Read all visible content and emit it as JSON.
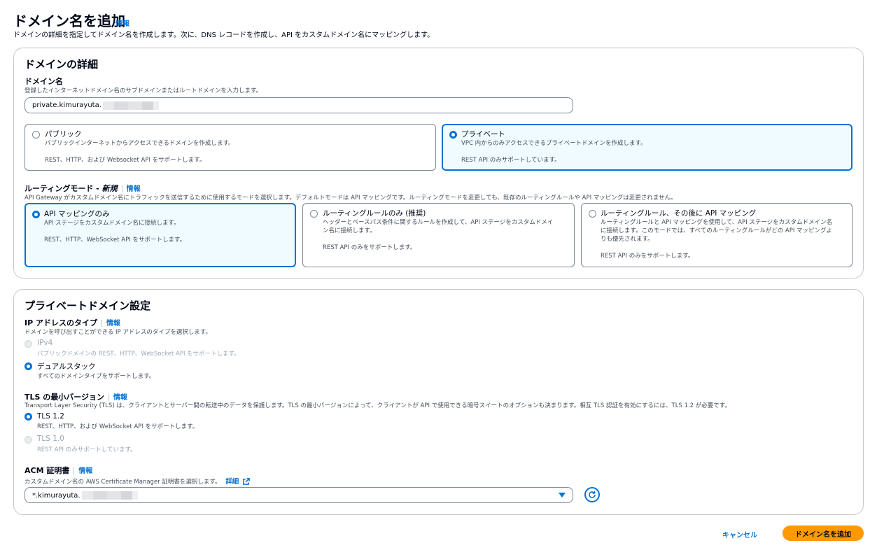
{
  "header": {
    "title": "ドメイン名を追加",
    "info": "情報",
    "description": "ドメインの詳細を指定してドメイン名を作成します。次に、DNS レコードを作成し、API をカスタムドメイン名にマッピングします。"
  },
  "domain_details": {
    "title": "ドメインの詳細",
    "domain_name_label": "ドメイン名",
    "domain_name_desc": "登録したインターネットドメイン名のサブドメインまたはルートドメインを入力します。",
    "domain_name_value": "private.kimurayuta.",
    "visibility": [
      {
        "title": "パブリック",
        "desc": "パブリックインターネットからアクセスできるドメインを作成します。",
        "note": "REST、HTTP、および Websocket API をサポートします。",
        "selected": false
      },
      {
        "title": "プライベート",
        "desc": "VPC 内からのみアクセスできるプライベートドメインを作成します。",
        "note": "REST API のみサポートしています。",
        "selected": true
      }
    ],
    "routing_label": "ルーティングモード - ",
    "routing_label_new": "新規",
    "routing_info": "情報",
    "routing_desc": "API Gateway がカスタムドメイン名にトラフィックを送信するために使用するモードを選択します。デフォルトモードは API マッピングです。ルーティングモードを変更しても、既存のルーティングルールや API マッピングは変更されません。",
    "routing_modes": [
      {
        "title": "API マッピングのみ",
        "desc1": "API ステージをカスタムドメイン名に接続します。",
        "desc2": "",
        "desc3": "",
        "note": "REST、HTTP、WebSocket API をサポートします。",
        "selected": true
      },
      {
        "title": "ルーティングルールのみ (推奨)",
        "desc1": "ヘッダーとベースパス条件に関するルールを作成して、API ステージをカスタムドメイ",
        "desc2": "ン名に接続します。",
        "desc3": "",
        "note": "REST API のみをサポートします。",
        "selected": false
      },
      {
        "title": "ルーティングルール、その後に API マッピング",
        "desc1": "ルーティングルールと API マッピングを使用して、API ステージをカスタムドメイン名",
        "desc2": "に接続します。このモードでは、すべてのルーティングルールがどの API マッピングよ",
        "desc3": "りも優先されます。",
        "note": "REST API のみをサポートします。",
        "selected": false
      }
    ]
  },
  "private_settings": {
    "title": "プライベートドメイン設定",
    "ip_label": "IP アドレスのタイプ",
    "ip_info": "情報",
    "ip_desc": "ドメインを呼び出すことができる IP アドレスのタイプを選択します。",
    "ip_options": [
      {
        "title": "IPv4",
        "desc": "パブリックドメインの REST、HTTP、WebSocket API をサポートします。",
        "state": "disabled"
      },
      {
        "title": "デュアルスタック",
        "desc": "すべてのドメインタイプをサポートします。",
        "state": "selected"
      }
    ],
    "tls_label": "TLS の最小バージョン",
    "tls_info": "情報",
    "tls_desc": "Transport Layer Security (TLS) は、クライアントとサーバー間の転送中のデータを保護します。TLS の最小バージョンによって、クライアントが API で使用できる暗号スイートのオプションも決まります。相互 TLS 認証を有効にするには、TLS 1.2 が必要です。",
    "tls_options": [
      {
        "title": "TLS 1.2",
        "desc": "REST、HTTP、および WebSocket API をサポートします。",
        "state": "selected"
      },
      {
        "title": "TLS 1.0",
        "desc": "REST API のみサポートしています。",
        "state": "disabled"
      }
    ],
    "acm_label": "ACM 証明書",
    "acm_info": "情報",
    "acm_desc": "カスタムドメイン名の AWS Certificate Manager 証明書を選択します。",
    "acm_details_link": "詳細",
    "acm_value": "*.kimurayuta."
  },
  "footer": {
    "cancel": "キャンセル",
    "submit": "ドメイン名を追加"
  },
  "colors": {
    "accent": "#0972d3",
    "primary_button": "#ff9900",
    "selected_tile_bg": "#f0fbff"
  }
}
